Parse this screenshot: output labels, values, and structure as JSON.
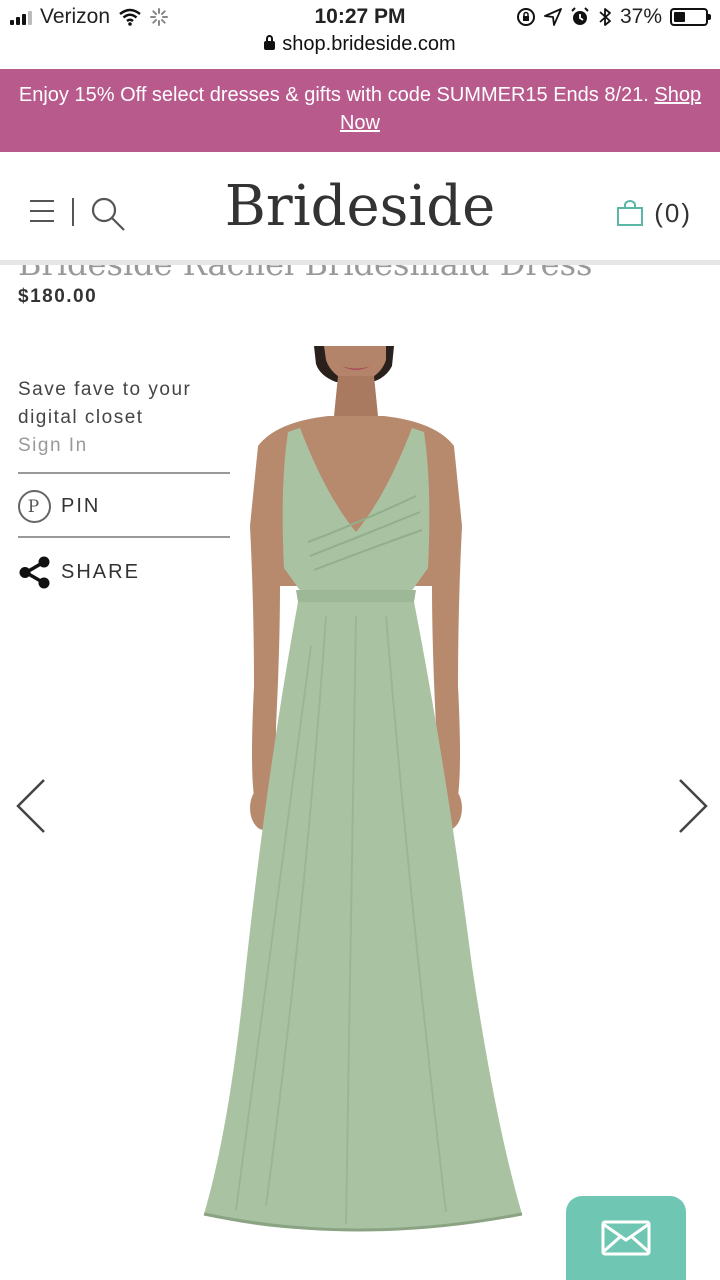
{
  "status_bar": {
    "carrier": "Verizon",
    "time": "10:27 PM",
    "battery": "37%",
    "battery_level": 0.37,
    "url": "shop.brideside.com"
  },
  "promo": {
    "text": "Enjoy 15% Off select dresses & gifts with code SUMMER15 Ends 8/21.",
    "link_label": "Shop Now"
  },
  "header": {
    "logo": "Brideside",
    "cart_count": "(0)"
  },
  "product": {
    "title": "Brideside Rachel Bridesmaid Dress",
    "price": "$180.00",
    "dress_color": "#a9c3a2"
  },
  "actions": {
    "fave_text": "Save fave to your digital closet",
    "sign_in": "Sign In",
    "pin_label": "PIN",
    "pin_glyph": "P",
    "share_label": "SHARE"
  },
  "colors": {
    "promo_bg": "#b95a8d",
    "accent_teal": "#6fc7b3",
    "cart_icon": "#5bb6a6"
  },
  "icons": {
    "menu": "hamburger-icon",
    "search": "search-icon",
    "cart": "shopping-bag-icon",
    "pin": "pinterest-icon",
    "share": "share-icon",
    "prev": "chevron-left-icon",
    "next": "chevron-right-icon",
    "chat": "envelope-icon"
  }
}
